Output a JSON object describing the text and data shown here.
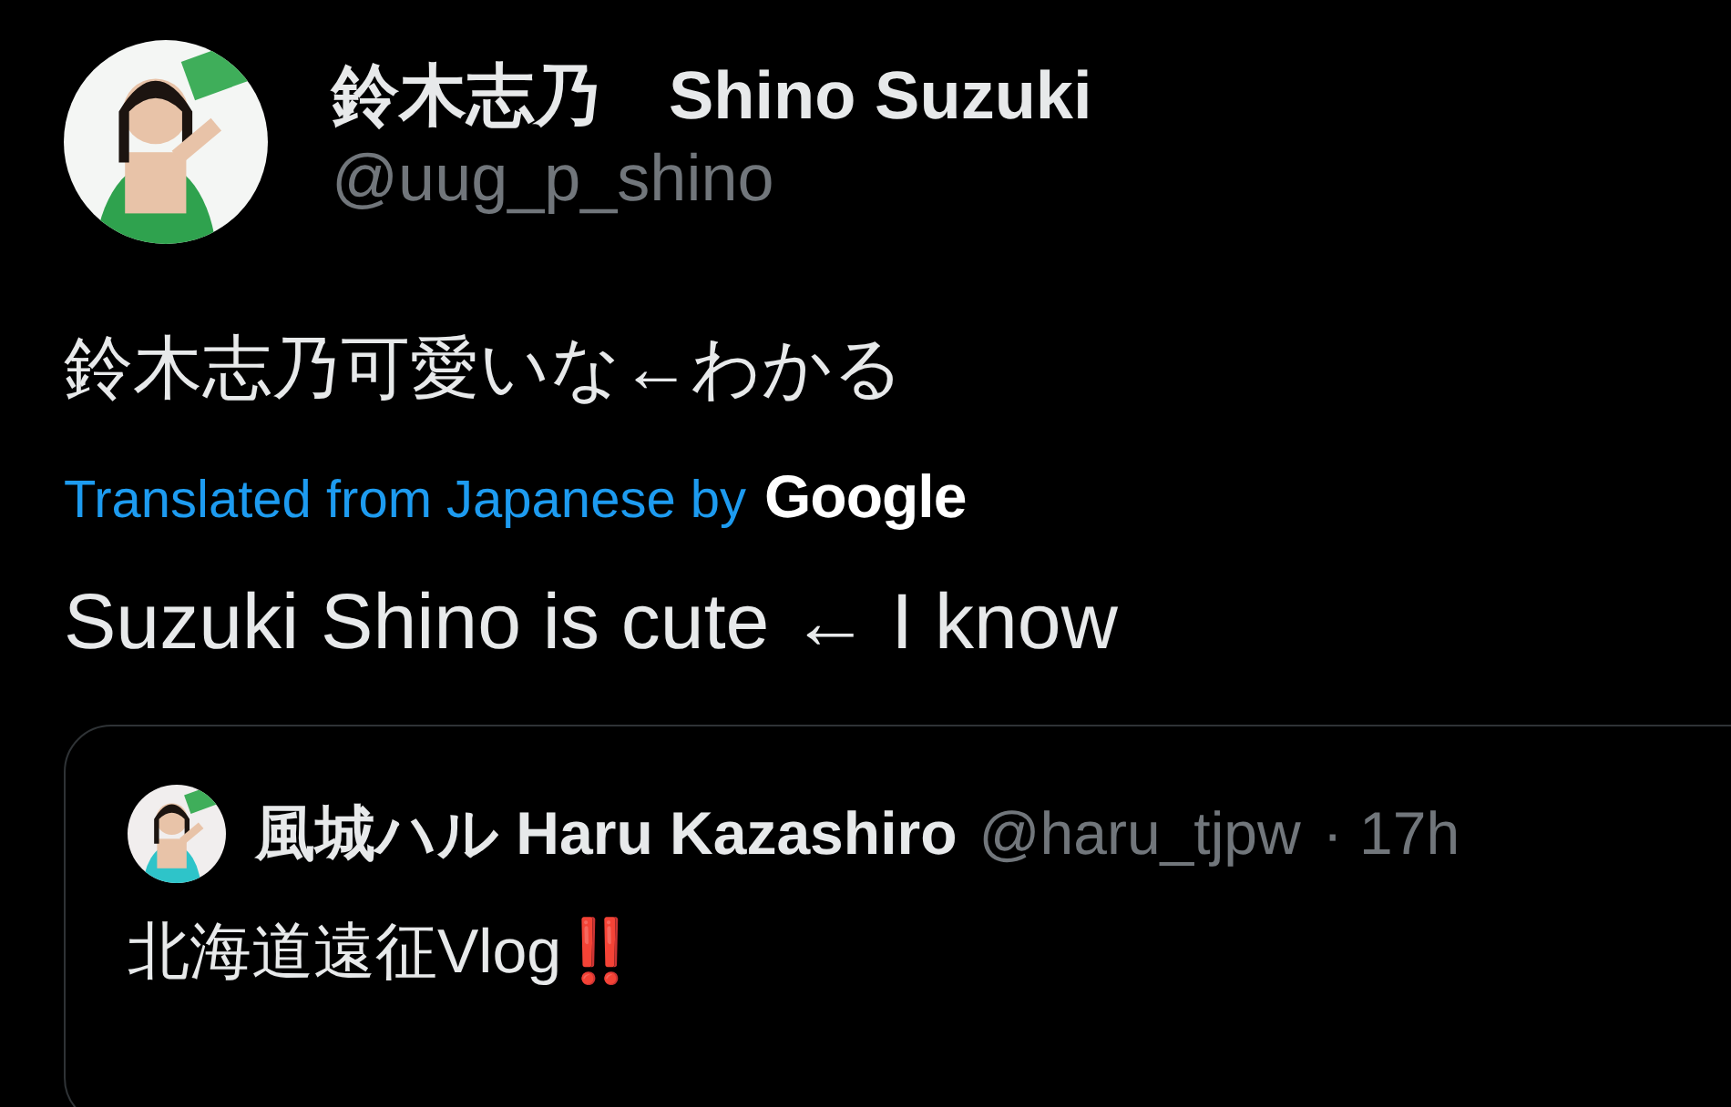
{
  "author": {
    "name": "鈴木志乃　Shino Suzuki",
    "handle": "@uug_p_shino"
  },
  "text": "鈴木志乃可愛いな←わかる",
  "translation": {
    "label": "Translated from Japanese by",
    "provider": "Google",
    "text": "Suzuki Shino is cute ← I know"
  },
  "quote": {
    "name": "風城ハル Haru Kazashiro",
    "handle": "@haru_tjpw",
    "time": "· 17h",
    "text": "北海道遠征Vlog‼️"
  }
}
